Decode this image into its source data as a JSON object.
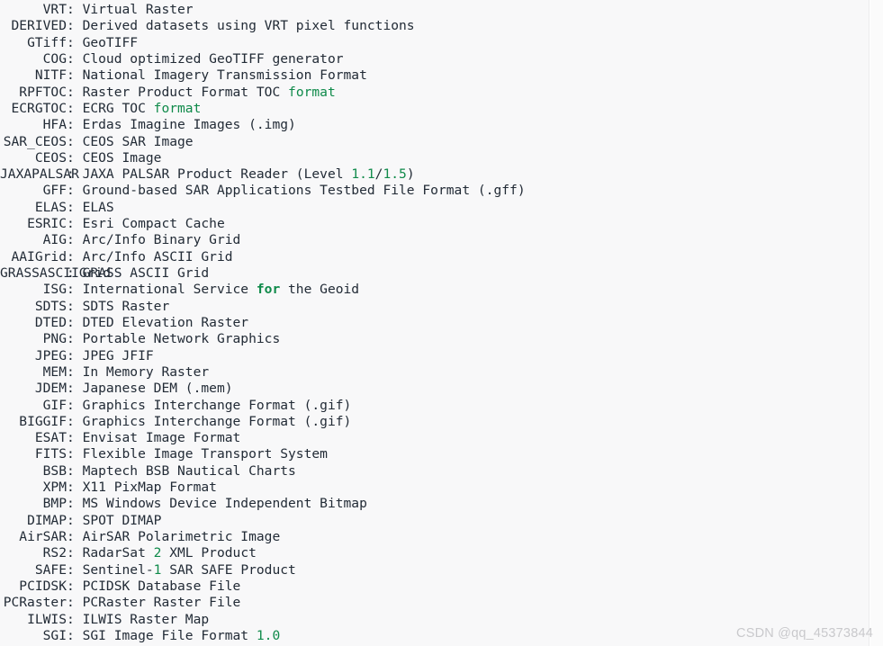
{
  "console": {
    "colors": {
      "background": "#f8f8f9",
      "text": "#222b36",
      "highlight_green": "#0f8a4a",
      "border": "#ececed",
      "watermark": "#c9c9cc"
    },
    "lines": [
      {
        "key": "VRT",
        "desc": "Virtual Raster"
      },
      {
        "key": "DERIVED",
        "desc": "Derived datasets using VRT pixel functions"
      },
      {
        "key": "GTiff",
        "desc": "GeoTIFF"
      },
      {
        "key": "COG",
        "desc": "Cloud optimized GeoTIFF generator"
      },
      {
        "key": "NITF",
        "desc": "National Imagery Transmission Format"
      },
      {
        "key": "RPFTOC",
        "desc": "Raster Product Format TOC ",
        "tail_kw": "format"
      },
      {
        "key": "ECRGTOC",
        "desc": "ECRG TOC ",
        "tail_kw": "format"
      },
      {
        "key": "HFA",
        "desc": "Erdas Imagine Images (.img)"
      },
      {
        "key": "SAR_CEOS",
        "desc": "CEOS SAR Image"
      },
      {
        "key": "CEOS",
        "desc": "CEOS Image"
      },
      {
        "key": "JAXAPALSAR",
        "desc": "JAXA PALSAR Product Reader (Level ",
        "tail_num": "1.1",
        "tail_mid": "/",
        "tail_num2": "1.5",
        "tail_end": ")"
      },
      {
        "key": "GFF",
        "desc": "Ground-based SAR Applications Testbed File Format (.gff)"
      },
      {
        "key": "ELAS",
        "desc": "ELAS"
      },
      {
        "key": "ESRIC",
        "desc": "Esri Compact Cache"
      },
      {
        "key": "AIG",
        "desc": "Arc/Info Binary Grid"
      },
      {
        "key": "AAIGrid",
        "desc": "Arc/Info ASCII Grid"
      },
      {
        "key": "GRASSASCIIGrid",
        "desc": "GRASS ASCII Grid"
      },
      {
        "key": "ISG",
        "desc": "International Service ",
        "tail_lit": "for",
        "tail_end2": " the Geoid"
      },
      {
        "key": "SDTS",
        "desc": "SDTS Raster"
      },
      {
        "key": "DTED",
        "desc": "DTED Elevation Raster"
      },
      {
        "key": "PNG",
        "desc": "Portable Network Graphics"
      },
      {
        "key": "JPEG",
        "desc": "JPEG JFIF"
      },
      {
        "key": "MEM",
        "desc": "In Memory Raster"
      },
      {
        "key": "JDEM",
        "desc": "Japanese DEM (.mem)"
      },
      {
        "key": "GIF",
        "desc": "Graphics Interchange Format (.gif)"
      },
      {
        "key": "BIGGIF",
        "desc": "Graphics Interchange Format (.gif)"
      },
      {
        "key": "ESAT",
        "desc": "Envisat Image Format"
      },
      {
        "key": "FITS",
        "desc": "Flexible Image Transport System"
      },
      {
        "key": "BSB",
        "desc": "Maptech BSB Nautical Charts"
      },
      {
        "key": "XPM",
        "desc": "X11 PixMap Format"
      },
      {
        "key": "BMP",
        "desc": "MS Windows Device Independent Bitmap"
      },
      {
        "key": "DIMAP",
        "desc": "SPOT DIMAP"
      },
      {
        "key": "AirSAR",
        "desc": "AirSAR Polarimetric Image"
      },
      {
        "key": "RS2",
        "desc": "RadarSat ",
        "tail_num": "2",
        "tail_end": " XML Product"
      },
      {
        "key": "SAFE",
        "desc": "Sentinel-",
        "tail_num": "1",
        "tail_end": " SAR SAFE Product"
      },
      {
        "key": "PCIDSK",
        "desc": "PCIDSK Database File"
      },
      {
        "key": "PCRaster",
        "desc": "PCRaster Raster File"
      },
      {
        "key": "ILWIS",
        "desc": "ILWIS Raster Map"
      },
      {
        "key": "SGI",
        "desc": "SGI Image File Format ",
        "tail_num": "1.0"
      }
    ]
  },
  "watermark": {
    "text": "CSDN @qq_45373844"
  }
}
